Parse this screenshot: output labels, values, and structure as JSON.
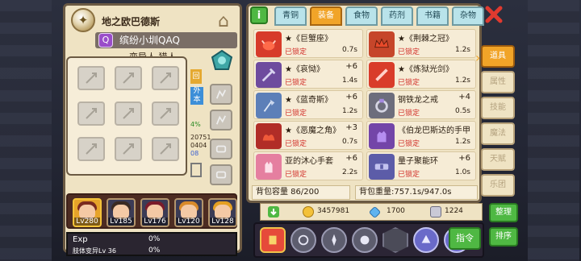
{
  "character": {
    "title": "地之欧巴德斯",
    "name": "缤纷小圳QAQ",
    "sub": "变异人 猎人",
    "stats": [
      "20751",
      "0404",
      "08",
      "4%"
    ],
    "side_tag": "外本",
    "side_tag2": "回"
  },
  "party": [
    {
      "level": "Lv280",
      "active": true
    },
    {
      "level": "Lv185",
      "active": false
    },
    {
      "level": "Lv176",
      "active": false
    },
    {
      "level": "Lv120",
      "active": false
    },
    {
      "level": "Lv128",
      "active": false
    }
  ],
  "exp": {
    "label": "Exp",
    "pct": "0%",
    "sub": "肢体变异Lv 36",
    "sub_pct": "0%"
  },
  "tabs": [
    {
      "label": "青铜",
      "active": false
    },
    {
      "label": "装备",
      "active": true
    },
    {
      "label": "食物",
      "active": false
    },
    {
      "label": "药剂",
      "active": false
    },
    {
      "label": "书籍",
      "active": false
    },
    {
      "label": "杂物",
      "active": false
    }
  ],
  "items": [
    {
      "name": "★《巨蟹座》",
      "lock": "已锁定",
      "amount": "",
      "weight": "0.7s",
      "icon": "crab-icon",
      "bg": "#d73b2a"
    },
    {
      "name": "★《荆棘之冠》",
      "lock": "已锁定",
      "amount": "",
      "weight": "1.2s",
      "icon": "crown-icon",
      "bg": "#c6462a"
    },
    {
      "name": "★《哀恸》",
      "lock": "已锁定",
      "amount": "+6",
      "weight": "1.4s",
      "icon": "sword-icon",
      "bg": "#6e4b9e"
    },
    {
      "name": "★《炼狱光剑》",
      "lock": "已锁定",
      "amount": "",
      "weight": "1.2s",
      "icon": "lightsaber-icon",
      "bg": "#d93c2a"
    },
    {
      "name": "★《蓝奇斯》",
      "lock": "已锁定",
      "amount": "+6",
      "weight": "1.2s",
      "icon": "axe-icon",
      "bg": "#5c7fb8"
    },
    {
      "name": "钢铁龙之戒",
      "lock": "已锁定",
      "amount": "+4",
      "weight": "0.5s",
      "icon": "ring-icon",
      "bg": "#6d6d7c"
    },
    {
      "name": "★《恶魔之角》",
      "lock": "已锁定",
      "amount": "+3",
      "weight": "0.7s",
      "icon": "demon-horn-icon",
      "bg": "#b12d27"
    },
    {
      "name": "《伯龙巴斯达的手甲",
      "lock": "已锁定",
      "amount": "",
      "weight": "1.2s",
      "icon": "gauntlet-icon",
      "bg": "#7345a8"
    },
    {
      "name": "亚的沐心手套",
      "lock": "已锁定",
      "amount": "+6",
      "weight": "2.2s",
      "icon": "glove-icon",
      "bg": "#e57fa0"
    },
    {
      "name": "量子聚能环",
      "lock": "已锁定",
      "amount": "+6",
      "weight": "1.0s",
      "icon": "belt-icon",
      "bg": "#5c5ca8"
    }
  ],
  "capacity": "背包容量 86/200",
  "weight": "背包重量:757.1s/947.0s",
  "side_tabs": [
    {
      "label": "道具",
      "active": true
    },
    {
      "label": "属性",
      "active": false
    },
    {
      "label": "技能",
      "active": false
    },
    {
      "label": "魔法",
      "active": false
    },
    {
      "label": "天赋",
      "active": false
    },
    {
      "label": "乐团",
      "active": false
    }
  ],
  "currency": {
    "gold": "3457981",
    "gem": "1700",
    "silver": "1224"
  },
  "buttons": {
    "sort": "整理",
    "order": "排序",
    "command": "指令"
  }
}
